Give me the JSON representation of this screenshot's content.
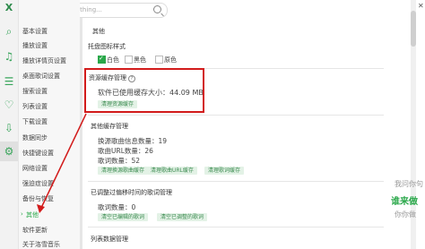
{
  "search": {
    "placeholder": "Search for something..."
  },
  "close_label": "X",
  "sidebar": {
    "items": [
      {
        "label": "基本设置"
      },
      {
        "label": "播放设置"
      },
      {
        "label": "播放详情页设置"
      },
      {
        "label": "桌面歌词设置"
      },
      {
        "label": "搜索设置"
      },
      {
        "label": "列表设置"
      },
      {
        "label": "下载设置"
      },
      {
        "label": "数据同步"
      },
      {
        "label": "快捷键设置"
      },
      {
        "label": "网络设置"
      },
      {
        "label": "强迫症设置"
      },
      {
        "label": "备份与恢复"
      },
      {
        "label": "其他",
        "active": true
      },
      {
        "label": "软件更新"
      },
      {
        "label": "关于洛雪音乐"
      }
    ]
  },
  "main": {
    "section_title": "其他",
    "tray_title": "托盘图标样式",
    "tray_options": [
      {
        "label": "白色",
        "checked": true
      },
      {
        "label": "黑色",
        "checked": false
      },
      {
        "label": "原色",
        "checked": false
      }
    ],
    "resource_cache_title": "资源缓存管理",
    "resource_cache_size": "软件已使用缓存大小：44.09 MB",
    "clear_resource_btn": "清理资源缓存",
    "other_cache_title": "其他缓存管理",
    "lyric_info_count": "换源歌曲信息数量：19",
    "song_url_count": "歌曲URL数量：26",
    "lyric_count": "歌词数量：52",
    "btn_clear_source": "清理换源歌曲缓存",
    "btn_clear_url": "清理歌曲URL缓存",
    "btn_clear_lyric": "清理歌词缓存",
    "edited_lyric_title": "已调整过偏移时间的歌词管理",
    "edited_lyric_count": "歌词数量：0",
    "btn_clear_edited": "清空已编辑的歌词",
    "btn_clear_edited2": "清空已调整的歌词",
    "list_data_title": "列表数据管理"
  },
  "watermark": [
    "我问你句",
    "谁来做",
    "你你做"
  ],
  "colors": {
    "accent": "#2aa84a",
    "annotation": "#d21b1b"
  }
}
